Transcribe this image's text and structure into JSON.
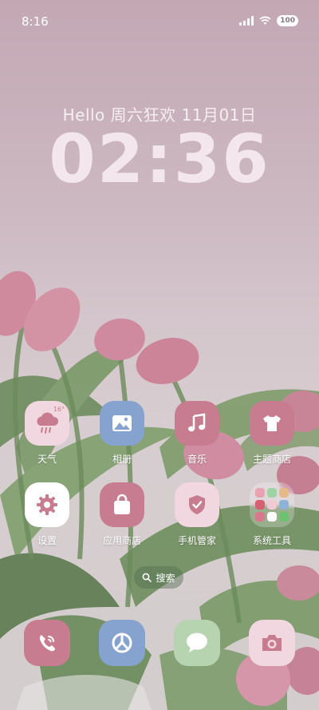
{
  "status_bar": {
    "time": "8:16",
    "battery": "100"
  },
  "greeting": "Hello  周六狂欢  11月01日",
  "clock": "02:36",
  "apps": {
    "weather": {
      "label": "天气",
      "temp": "16°"
    },
    "photos": {
      "label": "相册"
    },
    "music": {
      "label": "音乐"
    },
    "themes": {
      "label": "主题商店"
    },
    "settings": {
      "label": "设置"
    },
    "app_store": {
      "label": "应用商店"
    },
    "phone_manager": {
      "label": "手机管家"
    },
    "system_tools": {
      "label": "系统工具"
    }
  },
  "search": {
    "label": "搜索"
  },
  "dock": [
    "phone",
    "browser",
    "messages",
    "camera"
  ],
  "colors": {
    "app_pink": "#c77d8f",
    "app_blue": "#86a2cf",
    "app_green": "#b7d4b0"
  }
}
